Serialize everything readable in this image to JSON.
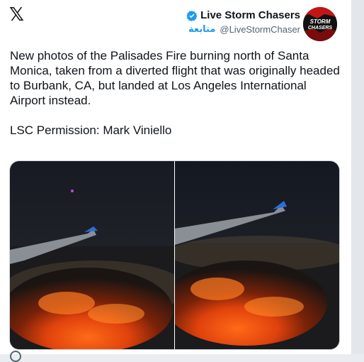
{
  "account": {
    "display_name": "Live Storm Chasers",
    "handle": "@LiveStormChaser",
    "follow_label": "متابعة",
    "avatar_text": "STORM CHASERS"
  },
  "tweet": {
    "text_line1": "New photos of the Palisades Fire burning north of Santa Monica, taken from a diverted flight that was originally headed to Burbank, CA, but landed at Los Angeles International Airport instead.",
    "text_line2": "LSC Permission: Mark Viniello"
  },
  "colors": {
    "accent": "#1d9bf0",
    "text": "#0f1419",
    "muted": "#536471",
    "fire": "#ff5a10"
  },
  "icons": {
    "brand": "x-logo-icon",
    "verified": "verified-badge-icon"
  }
}
